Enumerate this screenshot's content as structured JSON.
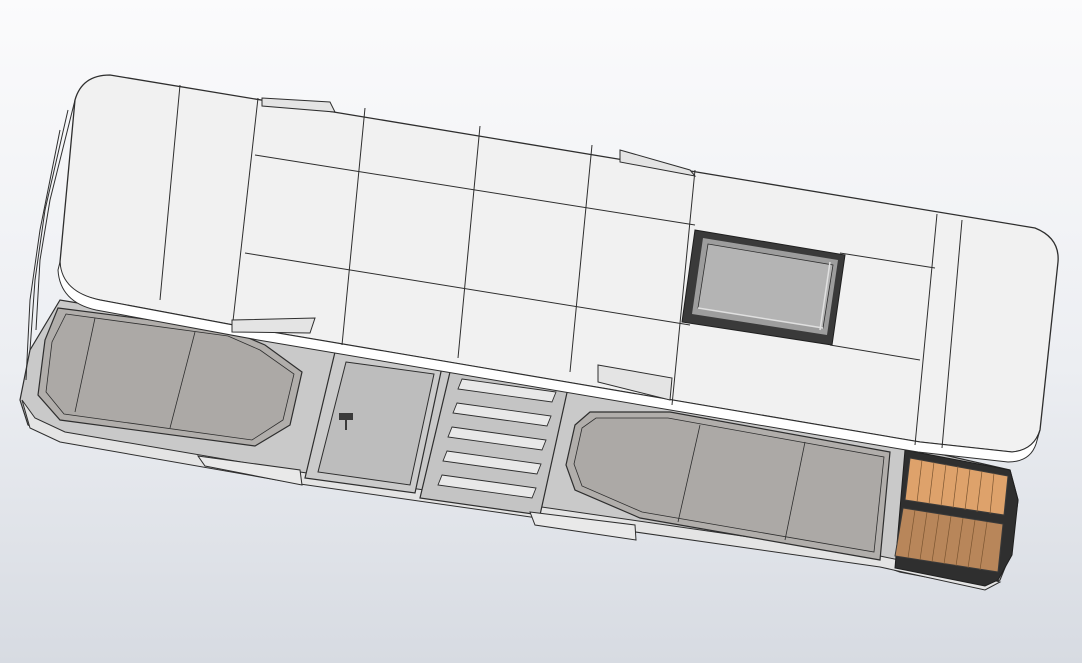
{
  "viewport": {
    "background_top": "#fbfbfc",
    "background_bottom": "#d7dbe2"
  },
  "model": {
    "name": "",
    "colors": {
      "roof": "#f1f1f1",
      "roof_edge": "#ffffff",
      "wall": "#cfcfcf",
      "glass": "#aaa7a4",
      "wood_light": "#dea26b",
      "wood_dark": "#b8865a",
      "frame": "#3a3a3a",
      "line": "#2e2e2e"
    }
  }
}
